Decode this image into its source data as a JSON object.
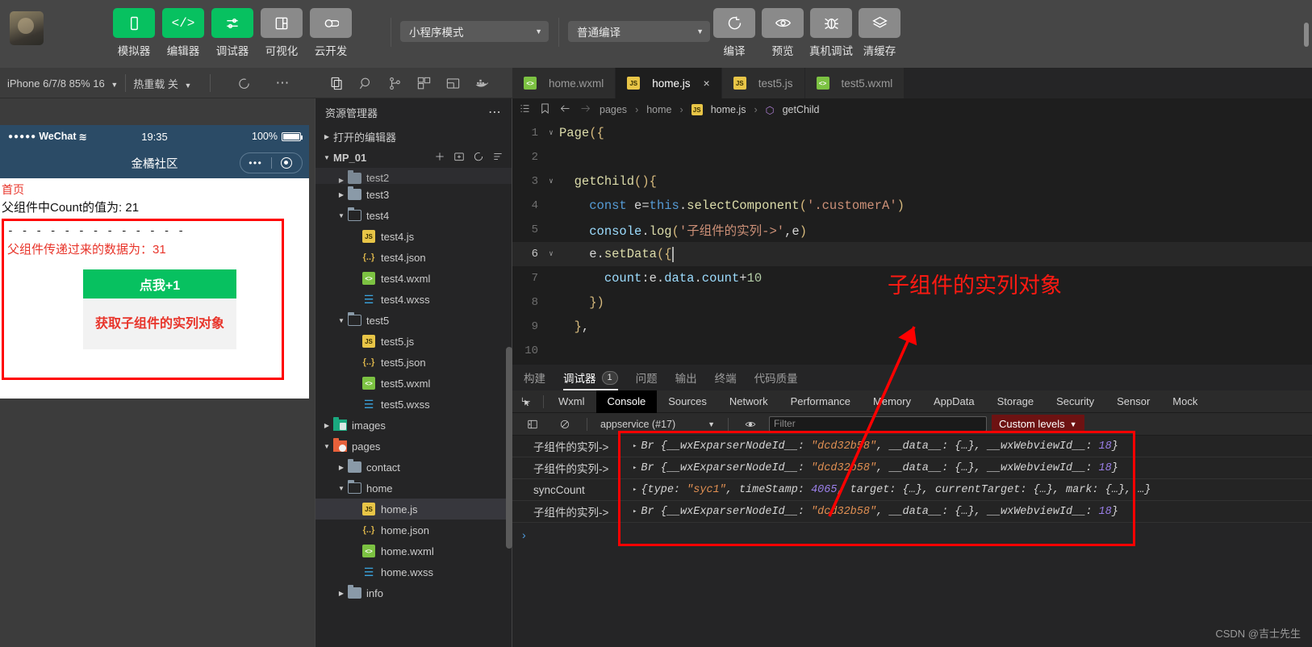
{
  "toolbar": {
    "tools": [
      {
        "label": "模拟器",
        "icon": "phone-icon",
        "color": "green"
      },
      {
        "label": "编辑器",
        "icon": "code-icon",
        "color": "green"
      },
      {
        "label": "调试器",
        "icon": "sliders-icon",
        "color": "green"
      },
      {
        "label": "可视化",
        "icon": "layout-icon",
        "color": "grey"
      },
      {
        "label": "云开发",
        "icon": "cloud-icon",
        "color": "grey"
      }
    ],
    "mode_select": "小程序模式",
    "compile_select": "普通编译",
    "actions": [
      {
        "label": "编译",
        "icon": "refresh-icon"
      },
      {
        "label": "预览",
        "icon": "eye-icon"
      },
      {
        "label": "真机调试",
        "icon": "bug-icon"
      },
      {
        "label": "清缓存",
        "icon": "layers-icon"
      }
    ]
  },
  "subbar": {
    "device": "iPhone 6/7/8 85% 16",
    "hotreload": "热重载 关",
    "refresh_icon": "refresh-icon",
    "more_icon": "more-icon",
    "activity_icons": [
      "files-icon",
      "search-icon",
      "source-control-icon",
      "extensions-icon",
      "debug-layout-icon",
      "docker-icon"
    ]
  },
  "simulator": {
    "status": {
      "carrier": "WeChat",
      "time": "19:35",
      "battery": "100%"
    },
    "nav_title": "金橘社区",
    "page": {
      "home_link": "首页",
      "count_line": "父组件中Count的值为: 21",
      "divider": "- - - - - - - - - - - - -",
      "passed_data": "父组件传递过来的数据为：31",
      "btn_primary": "点我+1",
      "btn_secondary": "获取子组件的实列对象"
    }
  },
  "explorer": {
    "title": "资源管理器",
    "more_icon": "more-icon",
    "open_editors": "打开的编辑器",
    "root": "MP_01",
    "root_actions": [
      "new-file-icon",
      "new-folder-icon",
      "refresh-icon",
      "collapse-all-icon"
    ],
    "tree": [
      {
        "name": "test2",
        "type": "folder",
        "state": "closed",
        "depth": 1,
        "partial": true
      },
      {
        "name": "test3",
        "type": "folder",
        "state": "closed",
        "depth": 1
      },
      {
        "name": "test4",
        "type": "folder",
        "state": "open",
        "depth": 1
      },
      {
        "name": "test4.js",
        "type": "js",
        "depth": 2
      },
      {
        "name": "test4.json",
        "type": "json",
        "depth": 2
      },
      {
        "name": "test4.wxml",
        "type": "wxml",
        "depth": 2
      },
      {
        "name": "test4.wxss",
        "type": "wxss",
        "depth": 2
      },
      {
        "name": "test5",
        "type": "folder",
        "state": "open",
        "depth": 1
      },
      {
        "name": "test5.js",
        "type": "js",
        "depth": 2
      },
      {
        "name": "test5.json",
        "type": "json",
        "depth": 2
      },
      {
        "name": "test5.wxml",
        "type": "wxml",
        "depth": 2
      },
      {
        "name": "test5.wxss",
        "type": "wxss",
        "depth": 2
      },
      {
        "name": "images",
        "type": "folder-images",
        "state": "closed",
        "depth": 0
      },
      {
        "name": "pages",
        "type": "folder-pages",
        "state": "open",
        "depth": 0
      },
      {
        "name": "contact",
        "type": "folder",
        "state": "closed",
        "depth": 1
      },
      {
        "name": "home",
        "type": "folder",
        "state": "open",
        "depth": 1
      },
      {
        "name": "home.js",
        "type": "js",
        "depth": 2,
        "selected": true
      },
      {
        "name": "home.json",
        "type": "json",
        "depth": 2
      },
      {
        "name": "home.wxml",
        "type": "wxml",
        "depth": 2
      },
      {
        "name": "home.wxss",
        "type": "wxss",
        "depth": 2
      },
      {
        "name": "info",
        "type": "folder",
        "state": "closed",
        "depth": 1
      }
    ]
  },
  "editor": {
    "tabs": [
      {
        "label": "home.wxml",
        "icon": "wxml",
        "active": false,
        "closable": false
      },
      {
        "label": "home.js",
        "icon": "js",
        "active": true,
        "closable": true,
        "close": "×"
      },
      {
        "label": "test5.js",
        "icon": "js",
        "active": false,
        "closable": false
      },
      {
        "label": "test5.wxml",
        "icon": "wxml",
        "active": false,
        "closable": false
      }
    ],
    "breadcrumb": [
      "pages",
      "home",
      "home.js",
      "getChild"
    ],
    "breadcrumb_icons": [
      "outline-icon",
      "bookmark-icon",
      "back-arrow-icon",
      "forward-arrow-icon"
    ],
    "lines": [
      {
        "n": "1",
        "fold": "∨",
        "text": "Page({"
      },
      {
        "n": "2",
        "fold": "",
        "text": ""
      },
      {
        "n": "3",
        "fold": "∨",
        "text": "  getChild(){"
      },
      {
        "n": "4",
        "fold": "",
        "text": "    const e=this.selectComponent('.customerA')"
      },
      {
        "n": "5",
        "fold": "",
        "text": "    console.log('子组件的实列->',e)"
      },
      {
        "n": "6",
        "fold": "∨",
        "text": "    e.setData({",
        "current": true
      },
      {
        "n": "7",
        "fold": "",
        "text": "      count:e.data.count+10"
      },
      {
        "n": "8",
        "fold": "",
        "text": "    })"
      },
      {
        "n": "9",
        "fold": "",
        "text": "  },"
      },
      {
        "n": "10",
        "fold": "",
        "text": ""
      }
    ],
    "annotation": "子组件的实列对象"
  },
  "debugger": {
    "panel_tabs": [
      {
        "label": "构建"
      },
      {
        "label": "调试器",
        "active": true,
        "badge": "1"
      },
      {
        "label": "问题"
      },
      {
        "label": "输出"
      },
      {
        "label": "终端"
      },
      {
        "label": "代码质量"
      }
    ],
    "inspect_icon": "inspect-icon",
    "devtools_tabs": [
      "Wxml",
      "Console",
      "Sources",
      "Network",
      "Performance",
      "Memory",
      "AppData",
      "Storage",
      "Security",
      "Sensor",
      "Mock"
    ],
    "devtools_active": "Console",
    "console_bar": {
      "sidebar_icon": "console-sidebar-icon",
      "clear_icon": "clear-icon",
      "context": "appservice (#17)",
      "eye_icon": "eye-icon",
      "filter_placeholder": "Filter",
      "levels": "Custom levels"
    },
    "console_rows": [
      {
        "tag": "子组件的实列->",
        "expand": "▸",
        "prefix": "Br {",
        "key": "__wxExparserNodeId__: ",
        "val": "\"dcd32b58\"",
        "rest": ", __data__: {…}, __wxWebviewId__: ",
        "num": "18",
        "tail": "}"
      },
      {
        "tag": "子组件的实列->",
        "expand": "▸",
        "prefix": "Br {",
        "key": "__wxExparserNodeId__: ",
        "val": "\"dcd32b58\"",
        "rest": ", __data__: {…}, __wxWebviewId__: ",
        "num": "18",
        "tail": "}"
      },
      {
        "tag": "syncCount",
        "expand": "▸",
        "prefix": "{",
        "key": "type: ",
        "val": "\"syc1\"",
        "rest": ", timeStamp: ",
        "num": "4065",
        "tail": ", target: {…}, currentTarget: {…}, mark: {…}, …}"
      },
      {
        "tag": "子组件的实列->",
        "expand": "▸",
        "prefix": "Br {",
        "key": "__wxExparserNodeId__: ",
        "val": "\"dcd32b58\"",
        "rest": ", __data__: {…}, __wxWebviewId__: ",
        "num": "18",
        "tail": "}"
      }
    ],
    "prompt": "›"
  },
  "watermark": "CSDN @吉士先生",
  "colors": {
    "accent": "#07c160",
    "annotation": "#ff0000",
    "editor_bg": "#1e1e1e"
  }
}
